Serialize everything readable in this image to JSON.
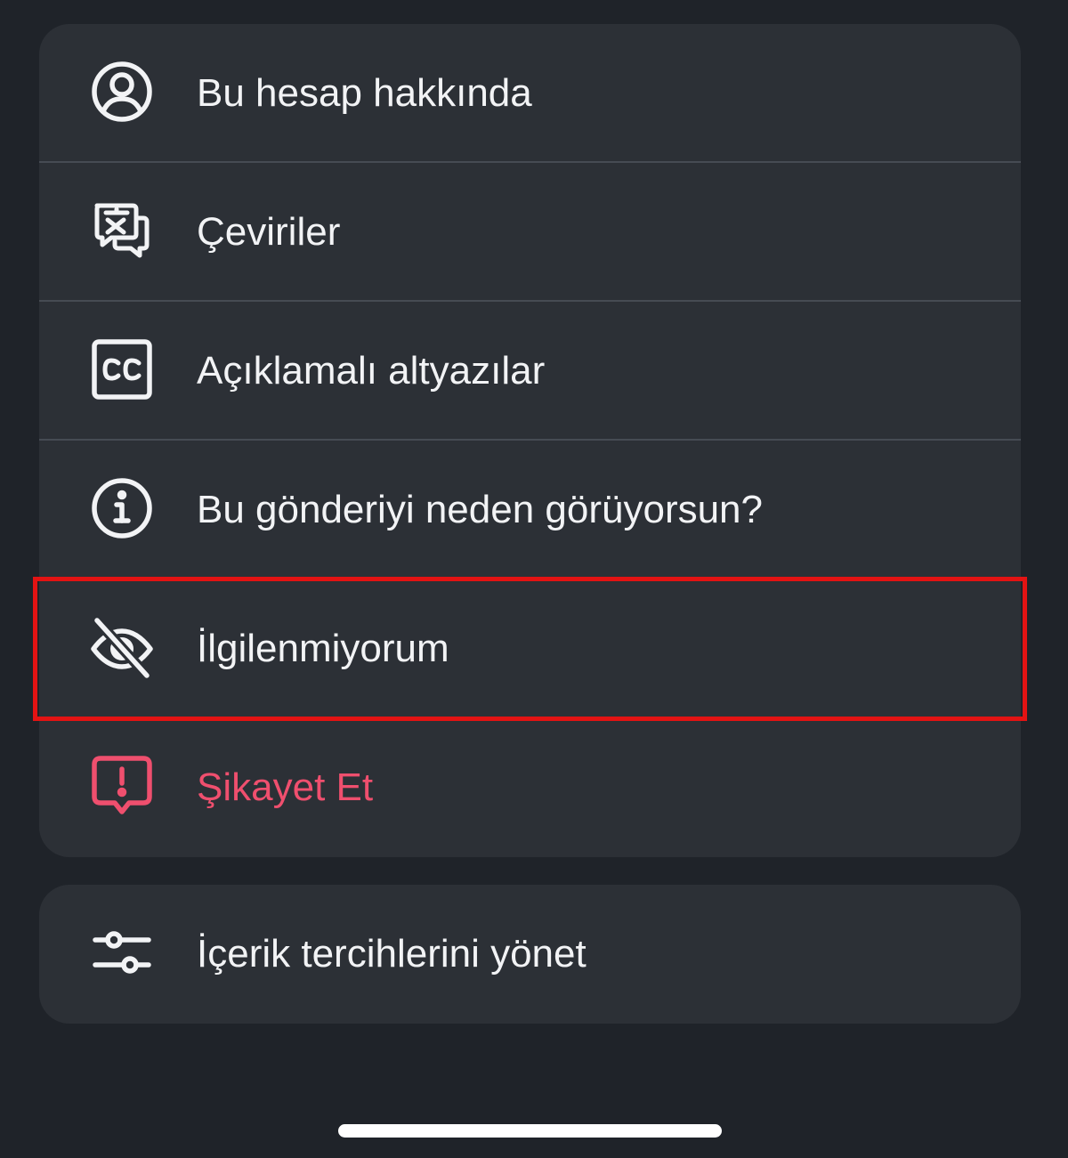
{
  "menu": {
    "items": [
      {
        "label": "Bu hesap hakkında",
        "icon": "account-circle-icon"
      },
      {
        "label": "Çeviriler",
        "icon": "translate-icon"
      },
      {
        "label": "Açıklamalı altyazılar",
        "icon": "closed-captions-icon"
      },
      {
        "label": "Bu gönderiyi neden görüyorsun?",
        "icon": "info-icon"
      },
      {
        "label": "İlgilenmiyorum",
        "icon": "eye-off-icon",
        "highlighted": true
      },
      {
        "label": "Şikayet Et",
        "icon": "report-icon",
        "color": "#ef4f6e"
      }
    ]
  },
  "preferences": {
    "label": "İçerik tercihlerini yönet",
    "icon": "sliders-icon"
  },
  "colors": {
    "background": "#1f2329",
    "card": "#2c3036",
    "text": "#f2f3f5",
    "danger": "#ef4f6e",
    "highlight": "#e31313"
  }
}
